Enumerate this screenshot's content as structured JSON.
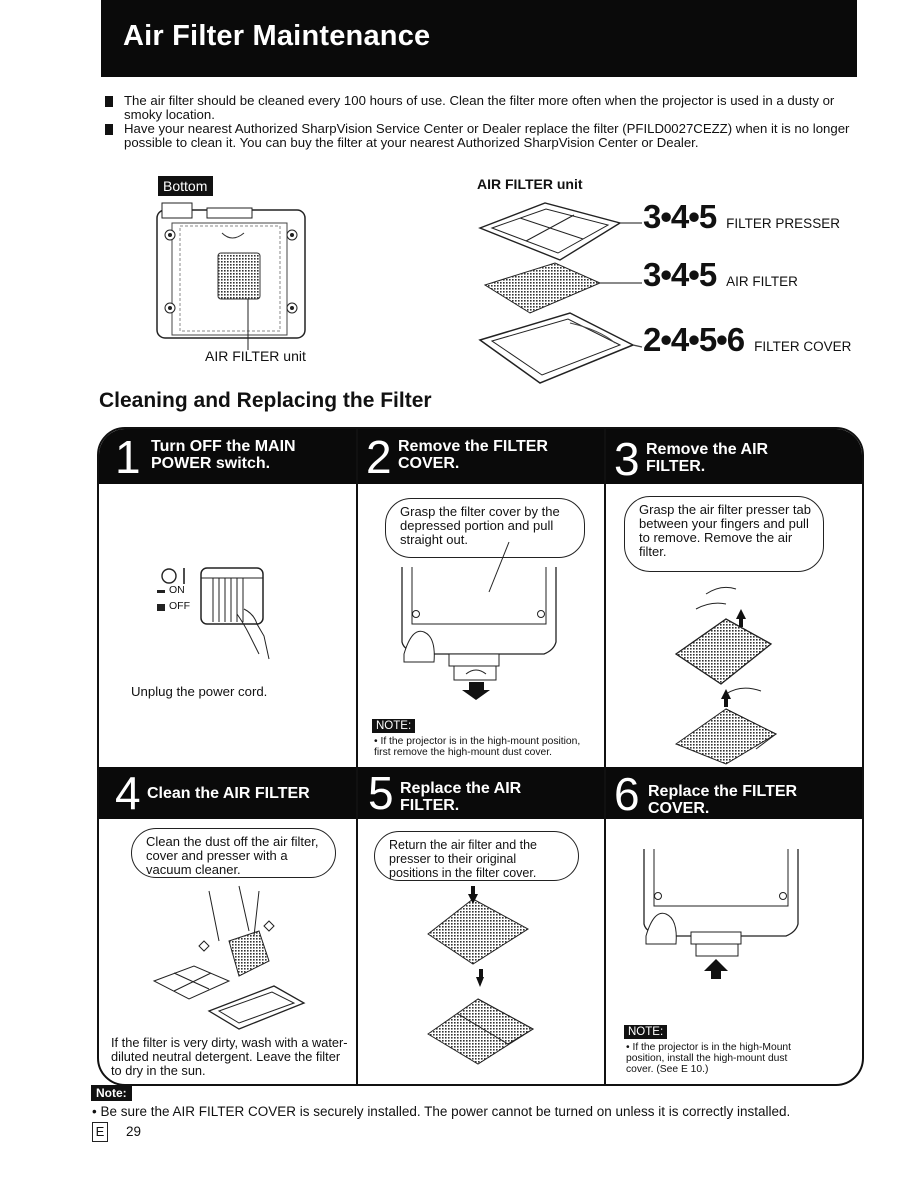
{
  "header": {
    "title": "Air Filter Maintenance"
  },
  "intro": {
    "bullets": [
      "The air filter should be cleaned every 100 hours of use. Clean the filter more often when the projector is used in a dusty or smoky location.",
      "Have your nearest Authorized SharpVision Service Center or Dealer replace the filter (PFILD0027CEZZ) when it is no longer possible to clean it. You can buy the filter at your nearest Authorized SharpVision Center or Dealer."
    ]
  },
  "bottom_view": {
    "label": "Bottom",
    "caption": "AIR FILTER unit"
  },
  "filter_unit": {
    "title": "AIR FILTER unit",
    "parts": [
      {
        "steps": "3•4•5",
        "name": "FILTER PRESSER"
      },
      {
        "steps": "3•4•5",
        "name": "AIR FILTER"
      },
      {
        "steps": "2•4•5•6",
        "name": "FILTER COVER"
      }
    ]
  },
  "section": {
    "title": "Cleaning and Replacing the Filter"
  },
  "steps": [
    {
      "number": "1",
      "title": "Turn OFF the MAIN POWER switch.",
      "switch_labels": {
        "symbols": "O I",
        "on": "ON",
        "off": "OFF"
      },
      "text": "Unplug the power cord."
    },
    {
      "number": "2",
      "title": "Remove the FILTER COVER.",
      "bubble": "Grasp the filter cover by the depressed portion and pull straight out.",
      "note_label": "NOTE:",
      "note": "• If the projector is in the high-mount position, first remove the high-mount dust cover."
    },
    {
      "number": "3",
      "title": "Remove the AIR FILTER.",
      "bubble": "Grasp the air filter presser tab between your fingers and pull to remove. Remove the air filter."
    },
    {
      "number": "4",
      "title": "Clean the AIR FILTER",
      "bubble": "Clean the dust off the air filter, cover and presser with a vacuum cleaner.",
      "text": "If the filter is very dirty, wash with a water-diluted neutral detergent. Leave the filter to dry in the sun."
    },
    {
      "number": "5",
      "title": "Replace the AIR FILTER.",
      "bubble": "Return the air filter and the presser to their original positions in the filter cover."
    },
    {
      "number": "6",
      "title": "Replace the FILTER COVER.",
      "note_label": "NOTE:",
      "note": "• If the projector is in the high-Mount position, install the high-mount dust cover. (See E 10.)"
    }
  ],
  "footer": {
    "note_label": "Note:",
    "note": "• Be sure the AIR FILTER COVER is securely installed. The power cannot be turned on unless it is correctly installed.",
    "language_mark": "E",
    "page_number": "29"
  }
}
